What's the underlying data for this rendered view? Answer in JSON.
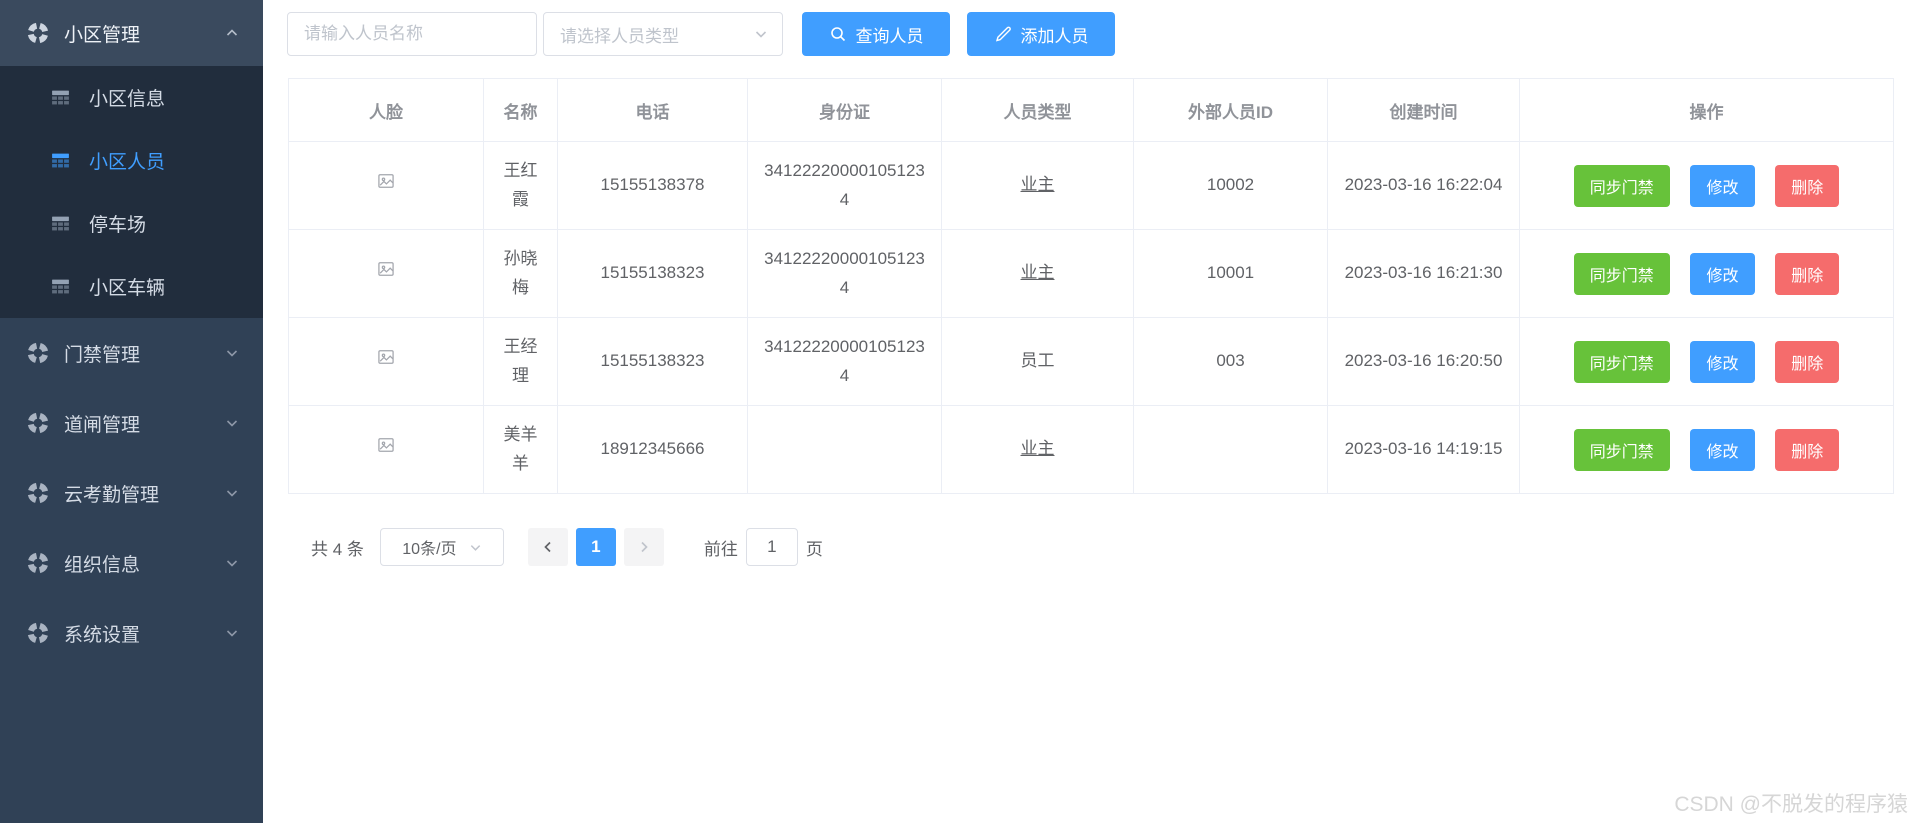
{
  "colors": {
    "accent": "#409eff",
    "success": "#67c23a",
    "danger": "#f56c6c",
    "sidebar_bg": "#304156",
    "sidebar_header_bg": "#3a4a5e",
    "submenu_bg": "#212d3d",
    "table_border": "#ebeef5",
    "header_text": "#909399",
    "cell_text": "#606266"
  },
  "sidebar": {
    "header": {
      "label": "小区管理",
      "expanded": true
    },
    "submenu": [
      {
        "label": "小区信息",
        "active": false
      },
      {
        "label": "小区人员",
        "active": true
      },
      {
        "label": "停车场",
        "active": false
      },
      {
        "label": "小区车辆",
        "active": false
      }
    ],
    "groups": [
      {
        "label": "门禁管理"
      },
      {
        "label": "道闸管理"
      },
      {
        "label": "云考勤管理"
      },
      {
        "label": "组织信息"
      },
      {
        "label": "系统设置"
      }
    ]
  },
  "toolbar": {
    "name_input_placeholder": "请输入人员名称",
    "type_select_placeholder": "请选择人员类型",
    "search_button": "查询人员",
    "add_button": "添加人员"
  },
  "table": {
    "columns": [
      "人脸",
      "名称",
      "电话",
      "身份证",
      "人员类型",
      "外部人员ID",
      "创建时间",
      "操作"
    ],
    "action_labels": {
      "sync": "同步门禁",
      "edit": "修改",
      "delete": "删除"
    },
    "rows": [
      {
        "name": "王红霞",
        "phone": "15155138378",
        "id_card": "341222200001051234",
        "person_type": "业主",
        "type_underlined": true,
        "external_id": "10002",
        "created_at": "2023-03-16 16:22:04"
      },
      {
        "name": "孙晓梅",
        "phone": "15155138323",
        "id_card": "341222200001051234",
        "person_type": "业主",
        "type_underlined": true,
        "external_id": "10001",
        "created_at": "2023-03-16 16:21:30"
      },
      {
        "name": "王经理",
        "phone": "15155138323",
        "id_card": "341222200001051234",
        "person_type": "员工",
        "type_underlined": false,
        "external_id": "003",
        "created_at": "2023-03-16 16:20:50"
      },
      {
        "name": "美羊羊",
        "phone": "18912345666",
        "id_card": "",
        "person_type": "业主",
        "type_underlined": true,
        "external_id": "",
        "created_at": "2023-03-16 14:19:15"
      }
    ]
  },
  "pagination": {
    "total_text": "共 4 条",
    "page_size": "10条/页",
    "current_page": "1",
    "goto_label": "前往",
    "goto_value": "1",
    "page_suffix": "页"
  },
  "watermark": "CSDN @不脱发的程序猿"
}
